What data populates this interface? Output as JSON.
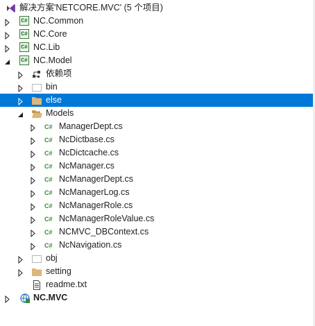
{
  "solution": {
    "label": "解决方案'NETCORE.MVC' (5 个项目)"
  },
  "projects": {
    "common": "NC.Common",
    "core": "NC.Core",
    "lib": "NC.Lib",
    "model": "NC.Model",
    "mvc": "NC.MVC"
  },
  "model_tree": {
    "dependencies": "依赖项",
    "bin": "bin",
    "else": "else",
    "models": "Models",
    "obj": "obj",
    "setting": "setting",
    "readme": "readme.txt"
  },
  "models_files": [
    "ManagerDept.cs",
    "NcDictbase.cs",
    "NcDictcache.cs",
    "NcManager.cs",
    "NcManagerDept.cs",
    "NcManagerLog.cs",
    "NcManagerRole.cs",
    "NcManagerRoleValue.cs",
    "NCMVC_DBContext.cs",
    "NcNavigation.cs"
  ],
  "icons": {
    "solution": "vs-solution-icon",
    "csproj": "csharp-project-icon",
    "cs_file": "csharp-file-icon",
    "folder": "folder-icon",
    "folder_open": "folder-open-icon",
    "dependencies": "dependencies-icon",
    "dotted_folder": "excluded-folder-icon",
    "text_file": "text-file-icon",
    "web_project": "web-project-icon"
  },
  "colors": {
    "selection": "#0078d7",
    "folder": "#dcb67a",
    "cs_green": "#388a34",
    "solution_purple": "#68217a"
  },
  "selected_item": "else"
}
